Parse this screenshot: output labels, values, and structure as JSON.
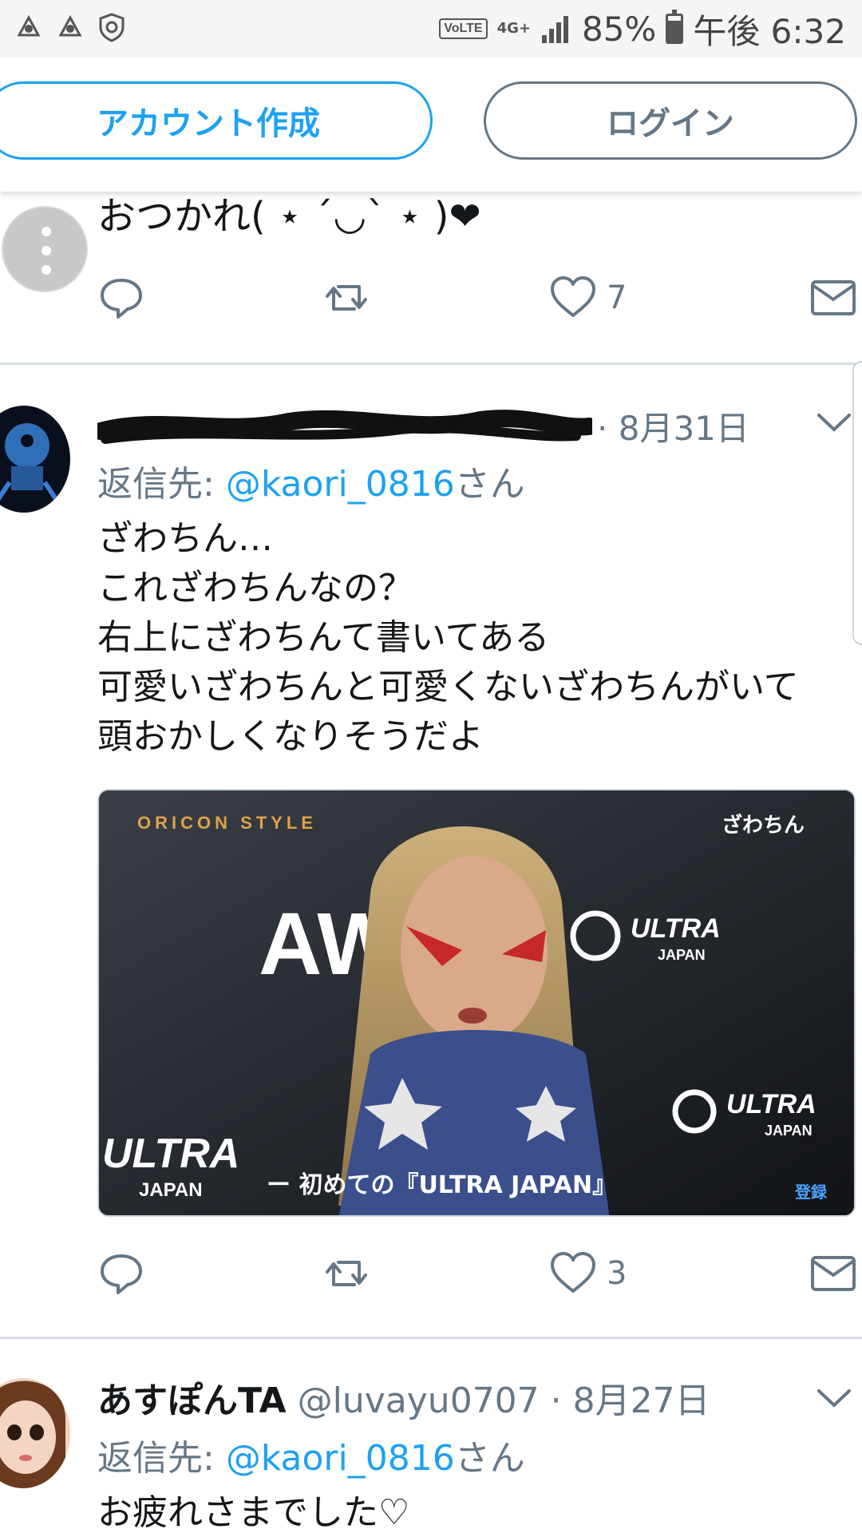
{
  "status_bar": {
    "volte": "VoLTE",
    "network": "4G+",
    "battery": "85%",
    "time": "午後 6:32"
  },
  "top_buttons": {
    "create_account": "アカウント作成",
    "login": "ログイン"
  },
  "tweets": [
    {
      "body": "おつかれ( ⋆ ´◡` ⋆ )❤",
      "actions": {
        "reply_count": "",
        "retweet_count": "",
        "like_count": "7"
      }
    },
    {
      "date": "8月31日",
      "reply_to_label": "返信先: ",
      "reply_to_handle": "@kaori_0816",
      "reply_to_suffix": "さん",
      "body_lines": [
        "ざわちん…",
        "これざわちんなの？",
        "右上にざわちんて書いてある",
        "可愛いざわちんと可愛くないざわちんがいて",
        "頭おかしくなりそうだよ"
      ],
      "media": {
        "logo": "ORICON STYLE",
        "name_tag": "ざわちん",
        "backdrop_text": "AWA",
        "ultra": "ULTRA",
        "japan": "JAPAN",
        "caption": "ー 初めての『ULTRA JAPAN』",
        "badge": "登録"
      },
      "actions": {
        "like_count": "3"
      }
    },
    {
      "name": "あすぽんTA",
      "handle": "@luvayu0707",
      "date": "8月27日",
      "separator": "·",
      "reply_to_label": "返信先: ",
      "reply_to_handle": "@kaori_0816",
      "reply_to_suffix": "さん",
      "body": "お疲れさまでした♡"
    }
  ],
  "colors": {
    "accent": "#1da1f2",
    "muted": "#657786",
    "heart": "#e0245e"
  }
}
